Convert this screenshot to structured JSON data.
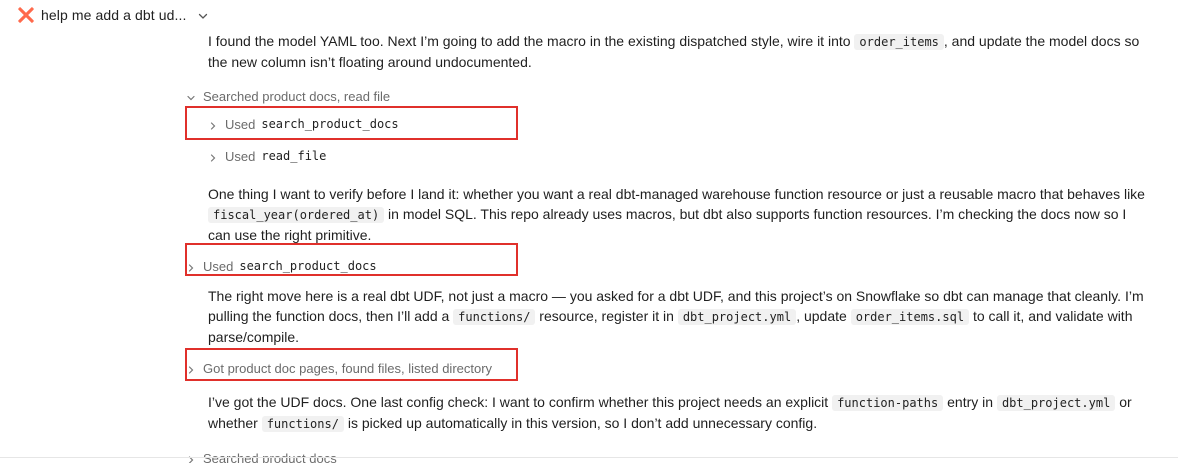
{
  "header": {
    "title": "help me add a dbt ud...",
    "logo_icon": "dbt-logo-icon",
    "chevron_icon": "chevron-down-icon"
  },
  "colors": {
    "accent": "#ff694b",
    "highlight": "#e0302b",
    "muted_text": "#6b6b6b"
  },
  "messages": {
    "m1": {
      "t1": "I found the model YAML too. Next I’m going to add the macro in the existing dispatched style, wire it into ",
      "c1": "order_items",
      "t2": ", and update the model docs so the new column isn’t floating around undocumented."
    },
    "group1": {
      "label": "Searched product docs, read file",
      "items": [
        {
          "prefix": "Used",
          "tool": "search_product_docs"
        },
        {
          "prefix": "Used",
          "tool": "read_file"
        }
      ]
    },
    "m2": {
      "t1": "One thing I want to verify before I land it: whether you want a real dbt-managed warehouse function resource or just a reusable macro that behaves like ",
      "c1": "fiscal_year(ordered_at)",
      "t2": " in model SQL. This repo already uses macros, but dbt also supports function resources. I’m checking the docs now so I can use the right primitive."
    },
    "row2": {
      "prefix": "Used",
      "tool": "search_product_docs"
    },
    "m3": {
      "t1": "The right move here is a real dbt UDF, not just a macro — you asked for a dbt UDF, and this project’s on Snowflake so dbt can manage that cleanly. I’m pulling the function docs, then I’ll add a ",
      "c1": "functions/",
      "t2": " resource, register it in ",
      "c2": "dbt_project.yml",
      "t3": ", update ",
      "c3": "order_items.sql",
      "t4": " to call it, and validate with parse/compile."
    },
    "row3": {
      "label": "Got product doc pages, found files, listed directory"
    },
    "m4": {
      "t1": "I’ve got the UDF docs. One last config check: I want to confirm whether this project needs an explicit ",
      "c1": "function-paths",
      "t2": " entry in ",
      "c2": "dbt_project.yml",
      "t3": " or whether ",
      "c3": "functions/",
      "t4": " is picked up automatically in this version, so I don’t add unnecessary config."
    },
    "row4": {
      "label": "Searched product docs"
    }
  }
}
